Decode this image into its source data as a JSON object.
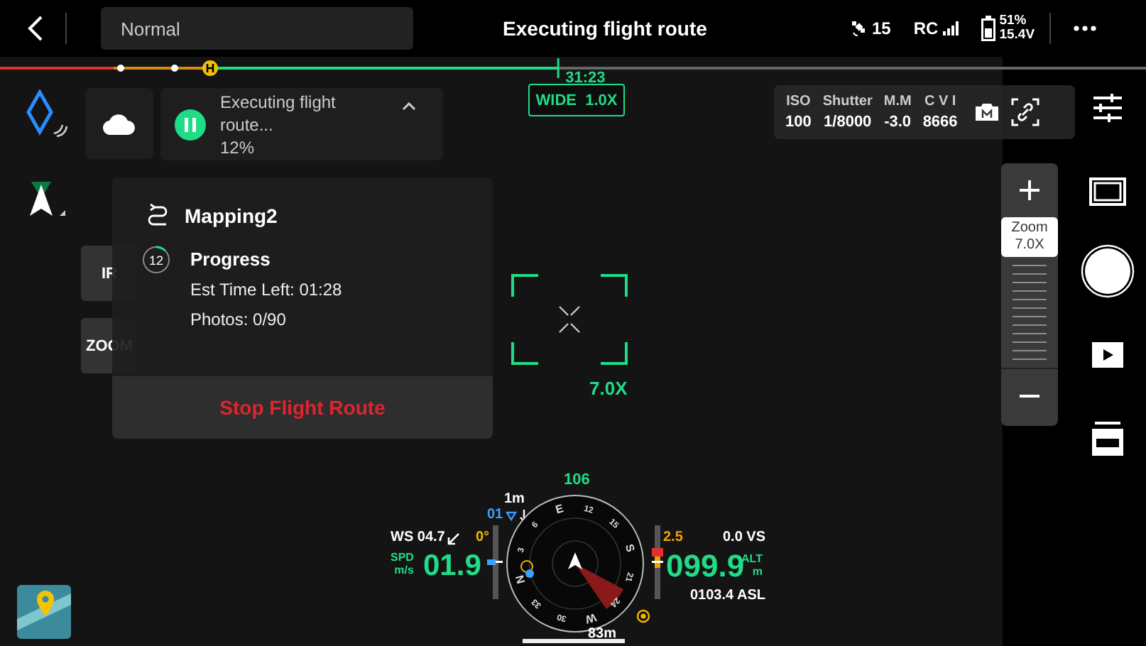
{
  "top_bar": {
    "mode": "Normal",
    "title": "Executing flight route",
    "satellites": "15",
    "rc": "RC",
    "battery_percent": "51%",
    "battery_voltage": "15.4V"
  },
  "timeline": {
    "time": "31:23",
    "level": 0.37
  },
  "lens": {
    "label": "WIDE  1.0X"
  },
  "camera": {
    "params": [
      {
        "label": "ISO",
        "value": "100"
      },
      {
        "label": "Shutter",
        "value": "1/8000"
      },
      {
        "label": "M.M",
        "value": "-3.0"
      },
      {
        "label": "C V I",
        "value": "8666"
      }
    ]
  },
  "mission": {
    "status": "Executing flight route...",
    "percent": "12%",
    "expanded": true,
    "name": "Mapping2",
    "progress_count": "12",
    "level": 0.12,
    "progress_title": "Progress",
    "time_left": "Est Time Left: 01:28",
    "photos": "Photos: 0/90",
    "stop_button": "Stop Flight Route"
  },
  "lens_buttons": [
    "IR",
    "ZOOM"
  ],
  "focus": {
    "zoom": "7.0X"
  },
  "zoom_control": {
    "label": "Zoom",
    "value": "7.0X"
  },
  "telemetry": {
    "heading": "106",
    "distance": "1m",
    "vertical_marker": "01",
    "wind": "WS 04.7",
    "gimbal": "0°",
    "speed_unit_top": "SPD",
    "speed_unit_bottom": "m/s",
    "speed": "01.9",
    "alt_limit": "2.5",
    "vertical_speed": "0.0 VS",
    "altitude": "099.9",
    "alt_unit_top": "ALT",
    "alt_unit_bottom": "m",
    "asl": "0103.4 ASL",
    "home_distance": "83m",
    "compass_labels": [
      "N",
      "3",
      "6",
      "E",
      "12",
      "15",
      "S",
      "21",
      "24",
      "W",
      "30",
      "33"
    ]
  }
}
